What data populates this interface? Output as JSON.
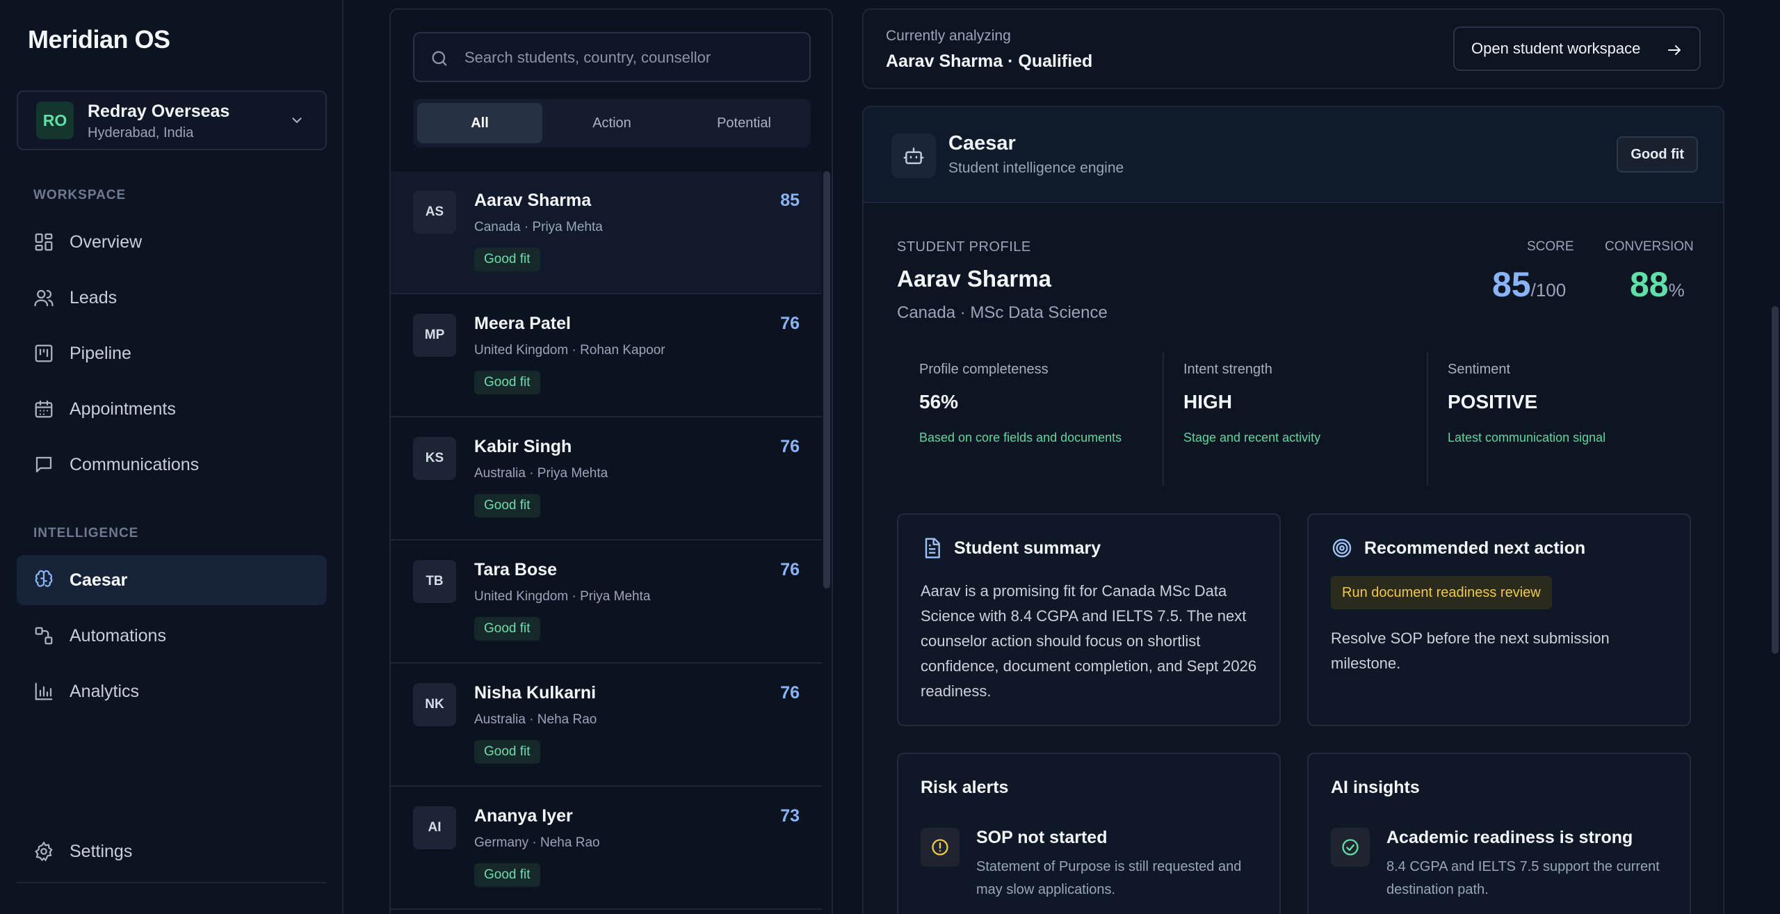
{
  "app": {
    "title": "Meridian OS"
  },
  "org": {
    "initials": "RO",
    "name": "Redray Overseas",
    "location": "Hyderabad, India"
  },
  "nav": {
    "workspace_label": "WORKSPACE",
    "intelligence_label": "INTELLIGENCE",
    "items": [
      {
        "label": "Overview",
        "icon": "grid-icon"
      },
      {
        "label": "Leads",
        "icon": "users-icon"
      },
      {
        "label": "Pipeline",
        "icon": "kanban-icon"
      },
      {
        "label": "Appointments",
        "icon": "calendar-icon"
      },
      {
        "label": "Communications",
        "icon": "message-icon"
      }
    ],
    "intel_items": [
      {
        "label": "Caesar",
        "icon": "brain-icon",
        "active": true
      },
      {
        "label": "Automations",
        "icon": "workflow-icon"
      },
      {
        "label": "Analytics",
        "icon": "bar-chart-icon"
      }
    ],
    "settings_label": "Settings"
  },
  "search": {
    "placeholder": "Search students, country, counsellor"
  },
  "filters": [
    "All",
    "Action",
    "Potential"
  ],
  "students": [
    {
      "initials": "AS",
      "name": "Aarav Sharma",
      "sub": "Canada · Priya Mehta",
      "score": "85",
      "badge": "Good fit"
    },
    {
      "initials": "MP",
      "name": "Meera Patel",
      "sub": "United Kingdom · Rohan Kapoor",
      "score": "76",
      "badge": "Good fit"
    },
    {
      "initials": "KS",
      "name": "Kabir Singh",
      "sub": "Australia · Priya Mehta",
      "score": "76",
      "badge": "Good fit"
    },
    {
      "initials": "TB",
      "name": "Tara Bose",
      "sub": "United Kingdom · Priya Mehta",
      "score": "76",
      "badge": "Good fit"
    },
    {
      "initials": "NK",
      "name": "Nisha Kulkarni",
      "sub": "Australia · Neha Rao",
      "score": "76",
      "badge": "Good fit"
    },
    {
      "initials": "AI",
      "name": "Ananya Iyer",
      "sub": "Germany · Neha Rao",
      "score": "73",
      "badge": "Good fit"
    }
  ],
  "analyzing": {
    "label": "Currently analyzing",
    "value": "Aarav Sharma · Qualified",
    "button": "Open student workspace"
  },
  "caesar": {
    "title": "Caesar",
    "subtitle": "Student intelligence engine",
    "fit_button": "Good fit",
    "profile_label": "STUDENT PROFILE",
    "name": "Aarav Sharma",
    "sub": "Canada · MSc Data Science",
    "score_label": "SCORE",
    "score": "85",
    "score_suffix": "/100",
    "conversion_label": "CONVERSION",
    "conversion": "88",
    "conversion_suffix": "%",
    "stats": [
      {
        "label": "Profile completeness",
        "value": "56%",
        "note": "Based on core fields and documents"
      },
      {
        "label": "Intent strength",
        "value": "HIGH",
        "note": "Stage and recent activity"
      },
      {
        "label": "Sentiment",
        "value": "POSITIVE",
        "note": "Latest communication signal"
      }
    ],
    "summary": {
      "title": "Student summary",
      "body": "Aarav is a promising fit for Canada MSc Data Science with 8.4 CGPA and IELTS 7.5. The next counselor action should focus on shortlist confidence, document completion, and Sept 2026 readiness."
    },
    "next_action": {
      "title": "Recommended next action",
      "pill": "Run document readiness review",
      "body": "Resolve SOP before the next submission milestone."
    },
    "risk": {
      "title": "Risk alerts",
      "item_title": "SOP not started",
      "item_text": "Statement of Purpose is still requested and may slow applications."
    },
    "insights": {
      "title": "AI insights",
      "item_title": "Academic readiness is strong",
      "item_text": "8.4 CGPA and IELTS 7.5 support the current destination path."
    }
  },
  "colors": {
    "accent_blue": "#8ab4f8",
    "accent_green": "#5fe0a8",
    "accent_yellow": "#f0c84a"
  }
}
